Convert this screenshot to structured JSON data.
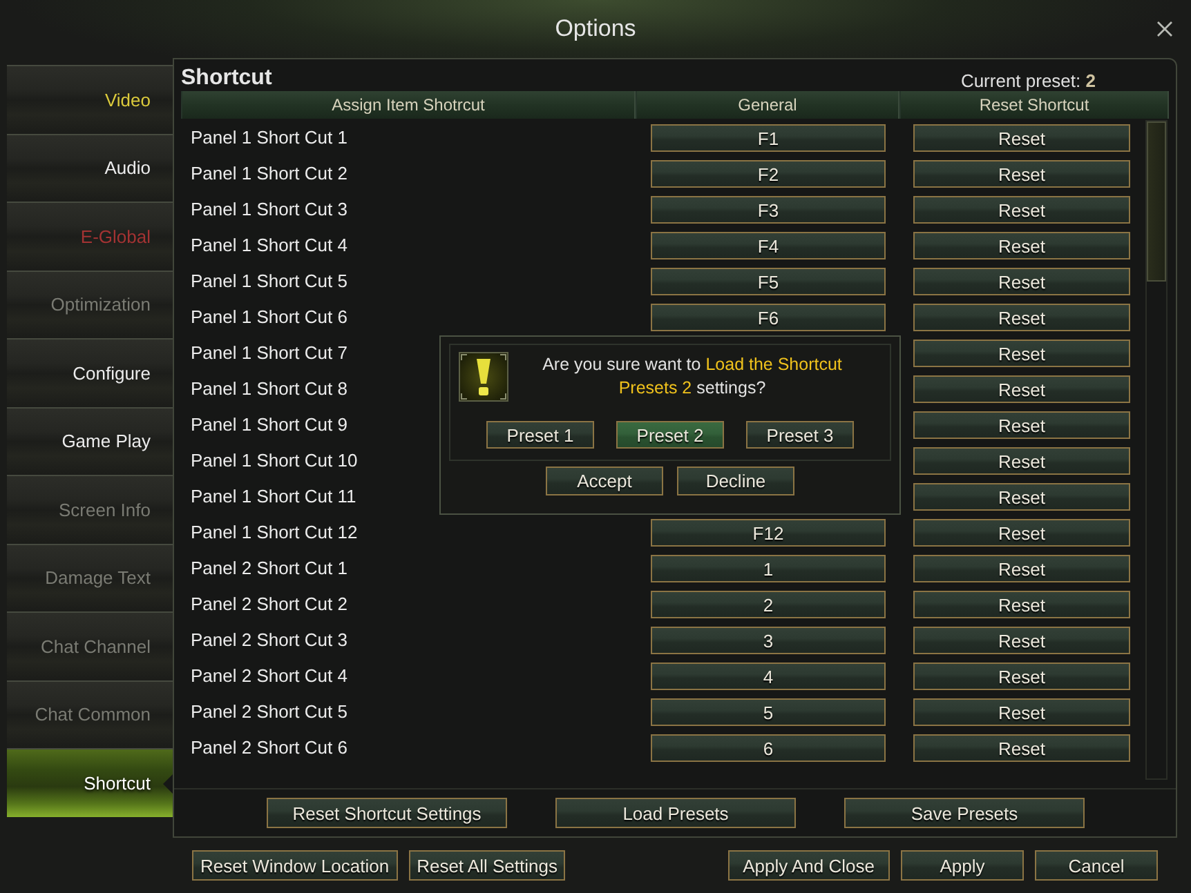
{
  "window": {
    "title": "Options"
  },
  "sidebar": {
    "items": [
      {
        "label": "Video",
        "selected": false,
        "disabled": false,
        "color": "#dccb3c"
      },
      {
        "label": "Audio",
        "selected": false,
        "disabled": false
      },
      {
        "label": "E-Global",
        "selected": false,
        "disabled": false,
        "color": "#a33333"
      },
      {
        "label": "Optimization",
        "selected": false,
        "disabled": true
      },
      {
        "label": "Configure",
        "selected": false,
        "disabled": false
      },
      {
        "label": "Game Play",
        "selected": false,
        "disabled": false
      },
      {
        "label": "Screen Info",
        "selected": false,
        "disabled": true
      },
      {
        "label": "Damage Text",
        "selected": false,
        "disabled": true
      },
      {
        "label": "Chat Channel",
        "selected": false,
        "disabled": true
      },
      {
        "label": "Chat Common",
        "selected": false,
        "disabled": true
      },
      {
        "label": "Shortcut",
        "selected": true,
        "disabled": false
      }
    ]
  },
  "panel": {
    "title": "Shortcut",
    "current_preset": "Current preset: **2**",
    "table": {
      "columns": [
        "Assign Item Shotrcut",
        "General",
        "Reset Shortcut"
      ],
      "rows": [
        {
          "label": "Panel 1 Short Cut 1",
          "key": "F1",
          "reset": "Reset"
        },
        {
          "label": "Panel 1 Short Cut 2",
          "key": "F2",
          "reset": "Reset"
        },
        {
          "label": "Panel 1 Short Cut 3",
          "key": "F3",
          "reset": "Reset"
        },
        {
          "label": "Panel 1 Short Cut 4",
          "key": "F4",
          "reset": "Reset"
        },
        {
          "label": "Panel 1 Short Cut 5",
          "key": "F5",
          "reset": "Reset"
        },
        {
          "label": "Panel 1 Short Cut 6",
          "key": "F6",
          "reset": "Reset"
        },
        {
          "label": "Panel 1 Short Cut 7",
          "reset": "Reset"
        },
        {
          "label": "Panel 1 Short Cut 8",
          "reset": "Reset"
        },
        {
          "label": "Panel 1 Short Cut 9",
          "reset": "Reset"
        },
        {
          "label": "Panel 1 Short Cut 10",
          "reset": "Reset"
        },
        {
          "label": "Panel 1 Short Cut 11",
          "reset": "Reset"
        },
        {
          "label": "Panel 1 Short Cut 12",
          "key": "F12",
          "reset": "Reset"
        },
        {
          "label": "Panel 2 Short Cut 1",
          "key": "1",
          "reset": "Reset"
        },
        {
          "label": "Panel 2 Short Cut 2",
          "key": "2",
          "reset": "Reset"
        },
        {
          "label": "Panel 2 Short Cut 3",
          "key": "3",
          "reset": "Reset"
        },
        {
          "label": "Panel 2 Short Cut 4",
          "key": "4",
          "reset": "Reset"
        },
        {
          "label": "Panel 2 Short Cut 5",
          "key": "5",
          "reset": "Reset"
        },
        {
          "label": "Panel 2 Short Cut 6",
          "key": "6",
          "reset": "Reset"
        }
      ]
    },
    "buttons": [
      "Reset Shortcut Settings",
      "Load Presets",
      "Save Presets"
    ]
  },
  "dialog": {
    "message": [
      {
        "text": "Are you sure want to ",
        "highlight": false
      },
      {
        "text": "Load the Shortcut Presets 2",
        "highlight": true
      },
      {
        "text": " settings?",
        "highlight": false
      }
    ],
    "presets": [
      {
        "label": "Preset 1",
        "selected": false
      },
      {
        "label": "Preset 2",
        "selected": true
      },
      {
        "label": "Preset 3",
        "selected": false
      }
    ],
    "buttons": [
      "Accept",
      "Decline"
    ]
  },
  "footer": {
    "left": [
      "Reset Window Location",
      "Reset All Settings"
    ],
    "right": [
      "Apply And Close",
      "Apply",
      "Cancel"
    ]
  }
}
